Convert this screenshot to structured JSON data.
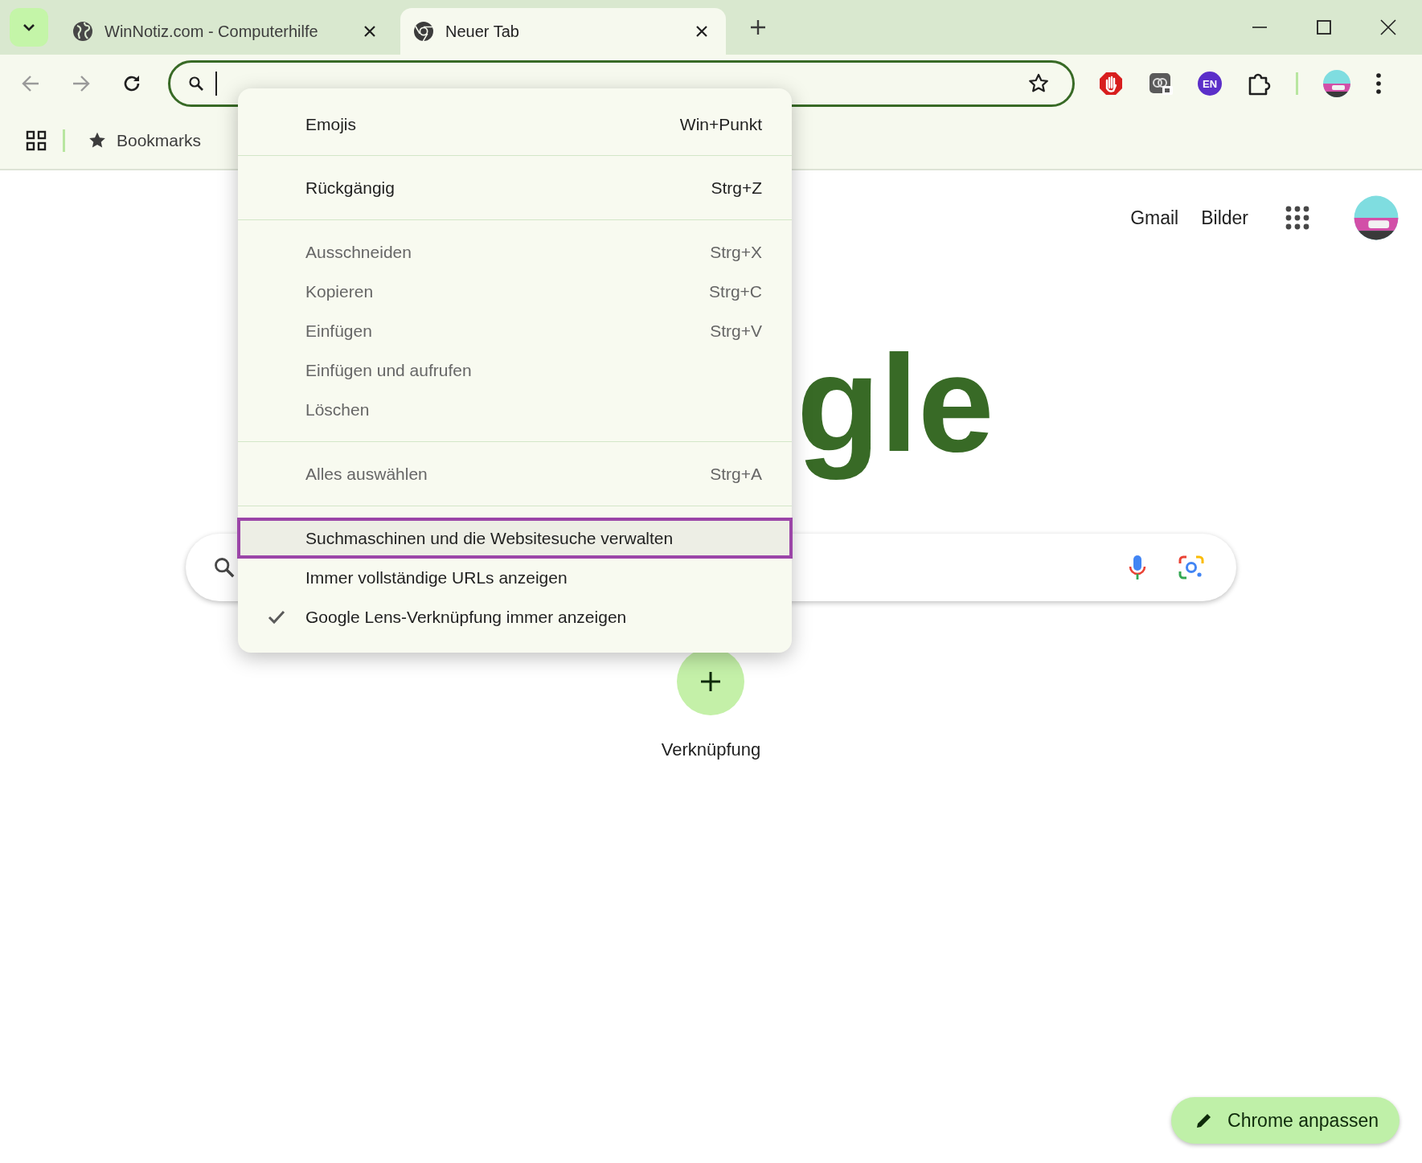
{
  "tabs": [
    {
      "kind": "website",
      "title": "WinNotiz.com - Computerhilfe",
      "selected": false
    },
    {
      "kind": "newtab",
      "title": "Neuer Tab",
      "selected": true
    }
  ],
  "toolbar": {
    "language_badge": "EN"
  },
  "bookmarks_bar": {
    "items": [
      {
        "label": "Bookmarks"
      }
    ]
  },
  "context_menu": {
    "sections": [
      {
        "items": [
          {
            "label": "Emojis",
            "shortcut": "Win+Punkt",
            "disabled": false,
            "checked": false,
            "selected": false
          }
        ]
      },
      {
        "items": [
          {
            "label": "Rückgängig",
            "shortcut": "Strg+Z",
            "disabled": false,
            "checked": false,
            "selected": false
          }
        ]
      },
      {
        "items": [
          {
            "label": "Ausschneiden",
            "shortcut": "Strg+X",
            "disabled": true,
            "checked": false,
            "selected": false
          },
          {
            "label": "Kopieren",
            "shortcut": "Strg+C",
            "disabled": true,
            "checked": false,
            "selected": false
          },
          {
            "label": "Einfügen",
            "shortcut": "Strg+V",
            "disabled": true,
            "checked": false,
            "selected": false
          },
          {
            "label": "Einfügen und aufrufen",
            "disabled": true,
            "checked": false,
            "selected": false
          },
          {
            "label": "Löschen",
            "disabled": true,
            "checked": false,
            "selected": false
          }
        ]
      },
      {
        "items": [
          {
            "label": "Alles auswählen",
            "shortcut": "Strg+A",
            "disabled": true,
            "checked": false,
            "selected": false
          }
        ]
      },
      {
        "items": [
          {
            "label": "Suchmaschinen und die Websitesuche verwalten",
            "disabled": false,
            "checked": false,
            "selected": true
          },
          {
            "label": "Immer vollständige URLs anzeigen",
            "disabled": false,
            "checked": false,
            "selected": false
          },
          {
            "label": "Google Lens-Verknüpfung immer anzeigen",
            "disabled": false,
            "checked": true,
            "selected": false
          }
        ]
      }
    ]
  },
  "page": {
    "top_links": [
      "Gmail",
      "Bilder"
    ],
    "logo": "gle",
    "shortcuts": [
      {
        "label": "Verknüpfung"
      }
    ],
    "customize_button": "Chrome anpassen"
  }
}
